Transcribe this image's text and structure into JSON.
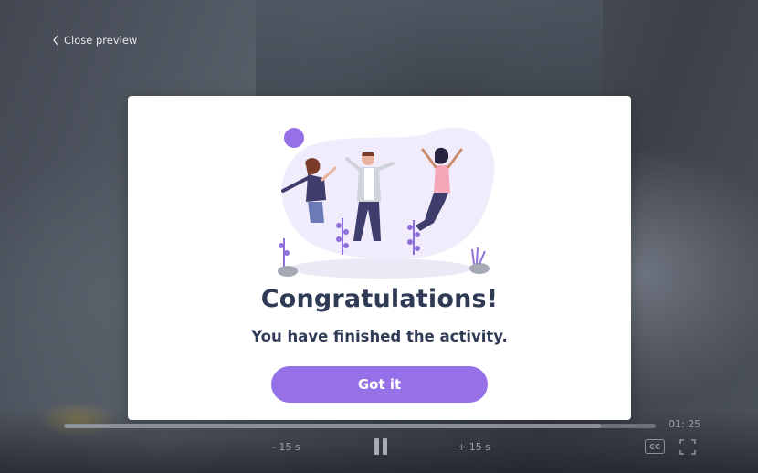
{
  "nav": {
    "close_preview": "Close preview"
  },
  "modal": {
    "title": "Congratulations!",
    "subtitle": "You have finished the activity.",
    "button": "Got it",
    "illustration": "people-jumping-celebration"
  },
  "player": {
    "time": "01: 25",
    "rewind": "- 15 s",
    "forward": "+ 15 s",
    "progress_fraction": 0.907,
    "cc_label": "CC",
    "state": "playing"
  },
  "colors": {
    "accent": "#9670e6",
    "title": "#2f3a55",
    "modal_bg": "#ffffff"
  },
  "icons": {
    "close_preview": "chevron-left-icon",
    "pause": "pause-icon",
    "cc": "closed-captions-icon",
    "fullscreen": "fullscreen-icon"
  }
}
